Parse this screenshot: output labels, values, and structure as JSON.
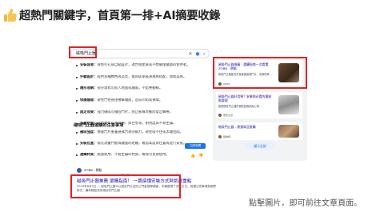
{
  "header": {
    "icon": "thumbs-up-icon",
    "title": "超熱門關鍵字，首頁第一排+AI摘要收錄"
  },
  "search": {
    "query": "磁吸門止器"
  },
  "overview": {
    "bullets": [
      {
        "label": "安裝容易：",
        "text": "採免打孔或自黏設計，適合租屋族或不想破壞牆面的使用者。"
      },
      {
        "label": "外觀設計：",
        "text": "提供多種顏色與造型，能與居家裝潢風格搭配，增加美感。"
      },
      {
        "label": "隱形收納：",
        "text": "部分款式可嵌入地面或牆面，不影響動線。"
      },
      {
        "label": "保護牆面：",
        "text": "避免門把直接撞擊牆面，造成凹陷或損壞。"
      },
      {
        "label": "固定效果：",
        "text": "強力磁吸可穩固門片，防止被風吹動而發出聲響。"
      },
      {
        "label": "多樣材質：",
        "text": "常見材質有不鏽鋼、鋅合金等，耐用度高不易生鏽。"
      }
    ],
    "subheading": "磁吸門止器選購的注意事項",
    "bullets2": [
      {
        "label": "磁吸強度：",
        "text": "依據門片重量選擇合適的磁力，避免吸不住或太難拉開。"
      },
      {
        "label": "安裝位置：",
        "text": "需先測量門板與牆面的距離，確認高度與位置再進行安裝。"
      },
      {
        "label": "選購材質：",
        "text": "挑選耐用、不易生鏽的材質，確保可長期使用。"
      }
    ],
    "tag": "立即查看"
  },
  "result": {
    "site": "ZOBB - 熱點",
    "url": "https://www.zobb.com.tw › 門止器",
    "title": "磁吸門止器推薦 選購指南！ 一篇搞懂安裝方式與挑選重點",
    "snippet": "2024年8月5日 — 磁吸門止器可以固定門片並防止門板撞擊牆面，本篇整理了安裝方式、挑選注意事項與推薦款式，讓你輕鬆找到適合的門止器 ..."
  },
  "panel": {
    "cards": [
      {
        "title": "磁吸門止器推薦｜選購指南一次看懂 - ZOBB - 熱點",
        "snippet": "磁吸門止器能有效保護牆面與門片，安裝簡單 ...",
        "source": "ZOBB"
      },
      {
        "title": "磁吸門止器好用嗎？安裝前必看的優缺點整理",
        "snippet": "整理磁吸門止器的優缺點與使用心得 ...",
        "source": "居家生活"
      },
      {
        "title": "磁吸門止器 - 熱銷商品推薦",
        "snippet": "",
        "source": "購物網"
      }
    ],
    "more": "顯示全部"
  },
  "footer": {
    "note": "點擊圖片，即可前往文章頁面。"
  }
}
